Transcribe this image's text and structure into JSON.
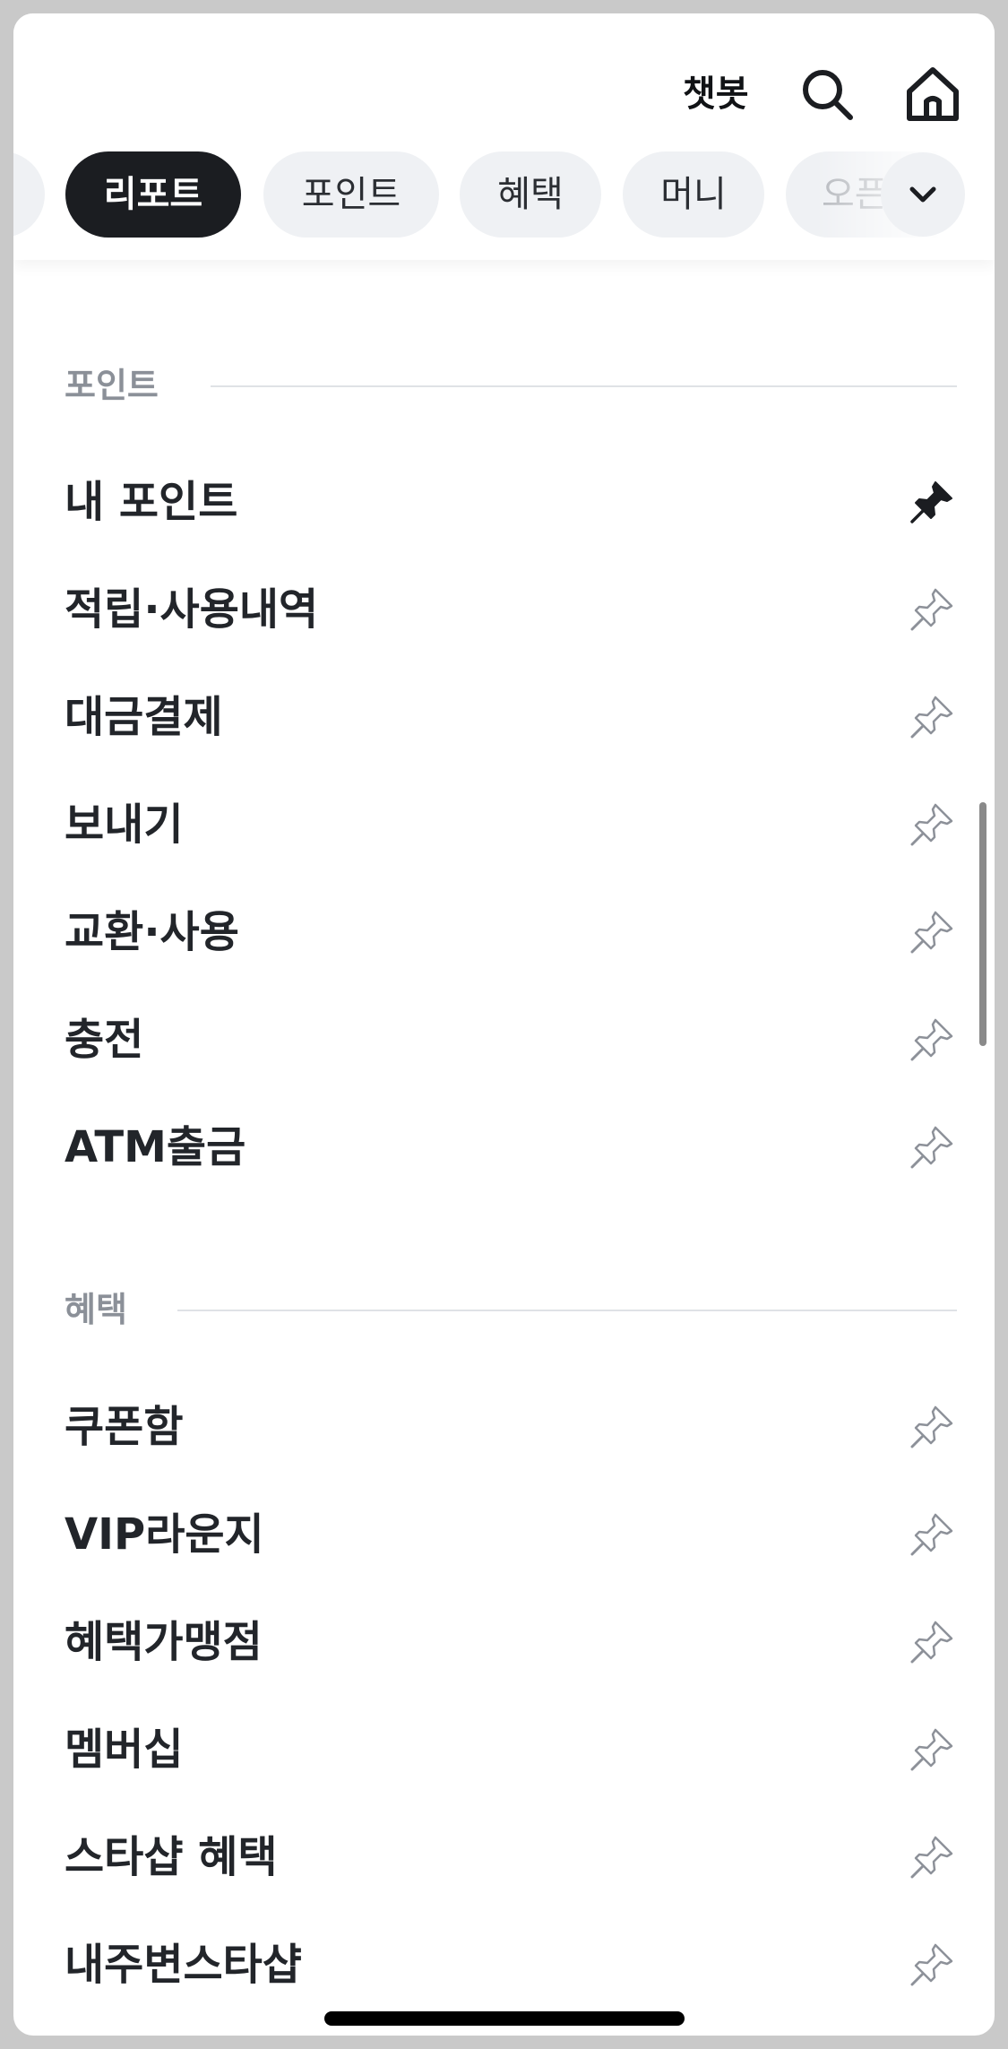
{
  "header": {
    "chatbot_label": "챗봇",
    "search_icon": "search-icon",
    "home_icon": "home-icon"
  },
  "tabs": [
    {
      "label": "",
      "state": "partial"
    },
    {
      "label": "리포트",
      "state": "active"
    },
    {
      "label": "포인트",
      "state": "normal"
    },
    {
      "label": "혜택",
      "state": "normal"
    },
    {
      "label": "머니",
      "state": "normal"
    },
    {
      "label": "오픈",
      "state": "faded"
    }
  ],
  "expand_icon": "chevron-down-icon",
  "sections": [
    {
      "title": "포인트",
      "items": [
        {
          "label": "내 포인트",
          "pinned": true
        },
        {
          "label": "적립·사용내역",
          "pinned": false
        },
        {
          "label": "대금결제",
          "pinned": false
        },
        {
          "label": "보내기",
          "pinned": false
        },
        {
          "label": "교환·사용",
          "pinned": false
        },
        {
          "label": "충전",
          "pinned": false
        },
        {
          "label": "ATM출금",
          "pinned": false
        }
      ]
    },
    {
      "title": "혜택",
      "items": [
        {
          "label": "쿠폰함",
          "pinned": false
        },
        {
          "label": "VIP라운지",
          "pinned": false
        },
        {
          "label": "혜택가맹점",
          "pinned": false
        },
        {
          "label": "멤버십",
          "pinned": false
        },
        {
          "label": "스타샵 혜택",
          "pinned": false
        },
        {
          "label": "내주변스타샵",
          "pinned": false
        }
      ]
    }
  ],
  "colors": {
    "active_chip_bg": "#1b1d21",
    "chip_bg": "#eff1f4",
    "section_title": "#8b9098",
    "text": "#22252a"
  }
}
